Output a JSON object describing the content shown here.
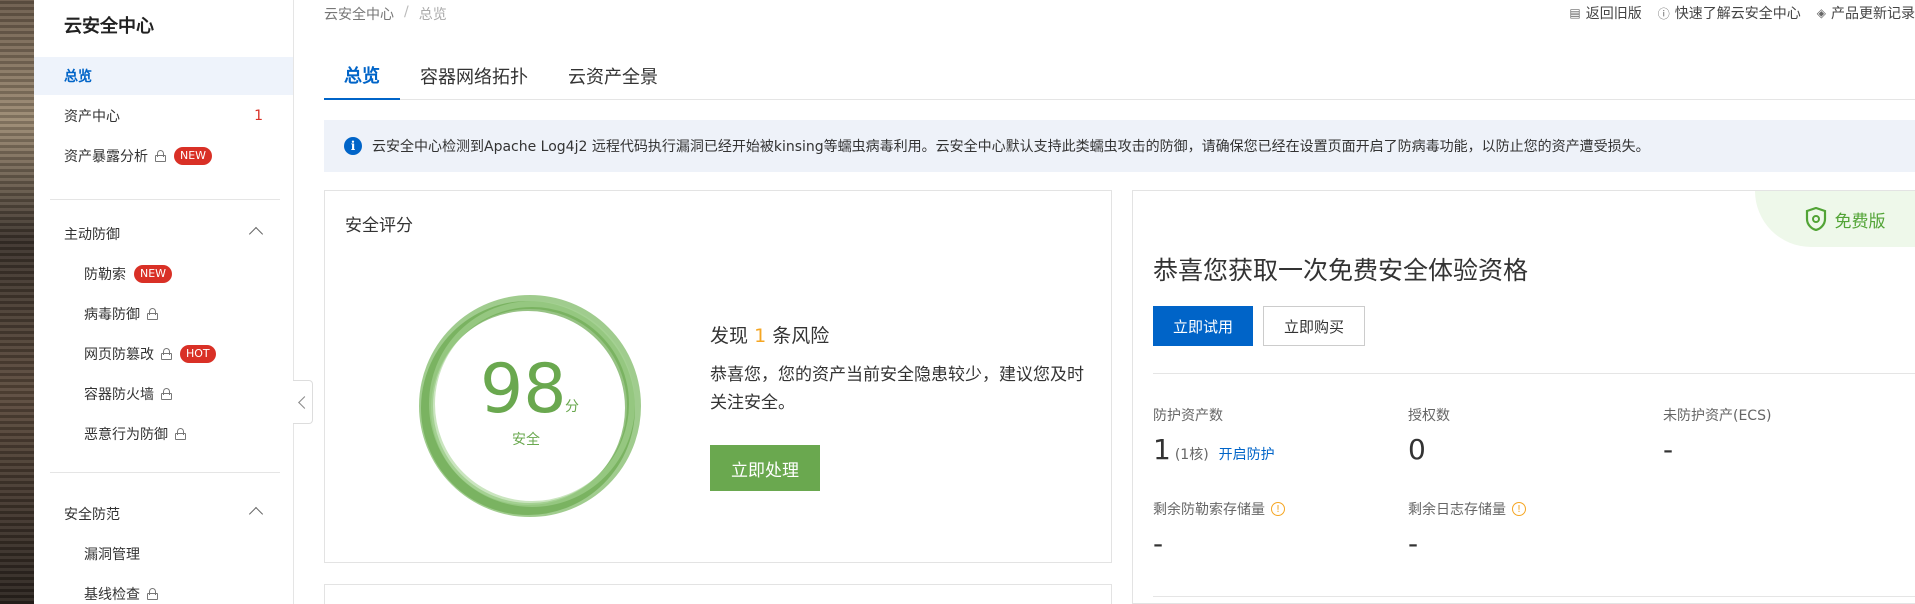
{
  "sidebar": {
    "title": "云安全中心",
    "items": [
      {
        "label": "总览"
      },
      {
        "label": "资产中心",
        "count": "1"
      },
      {
        "label": "资产暴露分析",
        "badge": "NEW"
      }
    ],
    "groups": [
      {
        "label": "主动防御",
        "items": [
          {
            "label": "防勒索",
            "badge": "NEW"
          },
          {
            "label": "病毒防御"
          },
          {
            "label": "网页防篡改",
            "badge": "HOT"
          },
          {
            "label": "容器防火墙"
          },
          {
            "label": "恶意行为防御"
          }
        ]
      },
      {
        "label": "安全防范",
        "items": [
          {
            "label": "漏洞管理"
          },
          {
            "label": "基线检查"
          }
        ]
      }
    ]
  },
  "breadcrumb": {
    "root": "云安全中心",
    "sep": "/",
    "current": "总览"
  },
  "toplinks": [
    "返回旧版",
    "快速了解云安全中心",
    "产品更新记录"
  ],
  "tabs": [
    "总览",
    "容器网络拓扑",
    "云资产全景"
  ],
  "notice": "云安全中心检测到Apache Log4j2 远程代码执行漏洞已经开始被kinsing等蠕虫病毒利用。云安全中心默认支持此类蠕虫攻击的防御，请确保您已经在设置页面开启了防病毒功能，以防止您的资产遭受损失。",
  "score_card": {
    "title": "安全评分",
    "score": "98",
    "unit": "分",
    "status": "安全",
    "risk_prefix": "发现",
    "risk_count": "1",
    "risk_suffix": "条风险",
    "description": "恭喜您，您的资产当前安全隐患较少，建议您及时关注安全。",
    "action": "立即处理"
  },
  "offer_card": {
    "tag": "免费版",
    "title": "恭喜您获取一次免费安全体验资格",
    "btn_try": "立即试用",
    "btn_buy": "立即购买",
    "stats": {
      "protected_label": "防护资产数",
      "protected_value": "1",
      "protected_core": "(1核)",
      "protected_link": "开启防护",
      "license_label": "授权数",
      "license_value": "0",
      "unprotected_label": "未防护资产(ECS)",
      "unprotected_value": "-",
      "ransom_label": "剩余防勒索存储量",
      "ransom_value": "-",
      "log_label": "剩余日志存储量",
      "log_value": "-"
    }
  },
  "colors": {
    "brand_blue": "#0064c8",
    "safe_green": "#6aa84f",
    "badge_red": "#d93026",
    "warn_orange": "#f5a623"
  }
}
